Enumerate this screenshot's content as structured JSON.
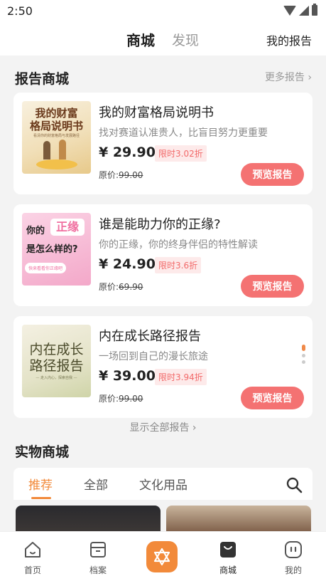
{
  "status": {
    "time": "2:50"
  },
  "topnav": {
    "tab_active": "商城",
    "tab_other": "发现",
    "my_report": "我的报告"
  },
  "report_section": {
    "title": "报告商城",
    "more": "更多报告 ›",
    "show_all": "显示全部报告 ›",
    "cards": [
      {
        "title": "我的财富格局说明书",
        "subtitle": "找对赛道认准贵人，比盲目努力更重要",
        "price": "¥ 29.90",
        "discount": "限时3.02折",
        "orig_label": "原价:",
        "orig_price": "99.00",
        "button": "预览报告",
        "thumb_title": "我的财富\n格局说明书",
        "thumb_sub": "看清你的财富格局与发展路径"
      },
      {
        "title": "谁是能助力你的正缘?",
        "subtitle": "你的正缘，你的终身伴侣的特性解读",
        "price": "¥ 24.90",
        "discount": "限时3.6折",
        "orig_label": "原价:",
        "orig_price": "69.90",
        "button": "预览报告",
        "thumb_a": "你的",
        "thumb_b": "正缘",
        "thumb_c": "是怎么样的?",
        "thumb_d": "快来看看你正缘吧"
      },
      {
        "title": "内在成长路径报告",
        "subtitle": "一场回到自己的漫长旅途",
        "price": "¥ 39.00",
        "discount": "限时3.94折",
        "orig_label": "原价:",
        "orig_price": "99.00",
        "button": "预览报告",
        "thumb_title": "内在成长\n路径报告",
        "thumb_sub": "— 走入内心，探索自我 —"
      }
    ]
  },
  "shop_section": {
    "title": "实物商城",
    "tabs": [
      "推荐",
      "全部",
      "文化用品"
    ]
  },
  "bottomnav": {
    "items": [
      "首页",
      "档案",
      "",
      "商城",
      "我的"
    ]
  },
  "colors": {
    "accent": "#f28a3a",
    "button": "#f47272",
    "discount_text": "#f26a6a"
  }
}
